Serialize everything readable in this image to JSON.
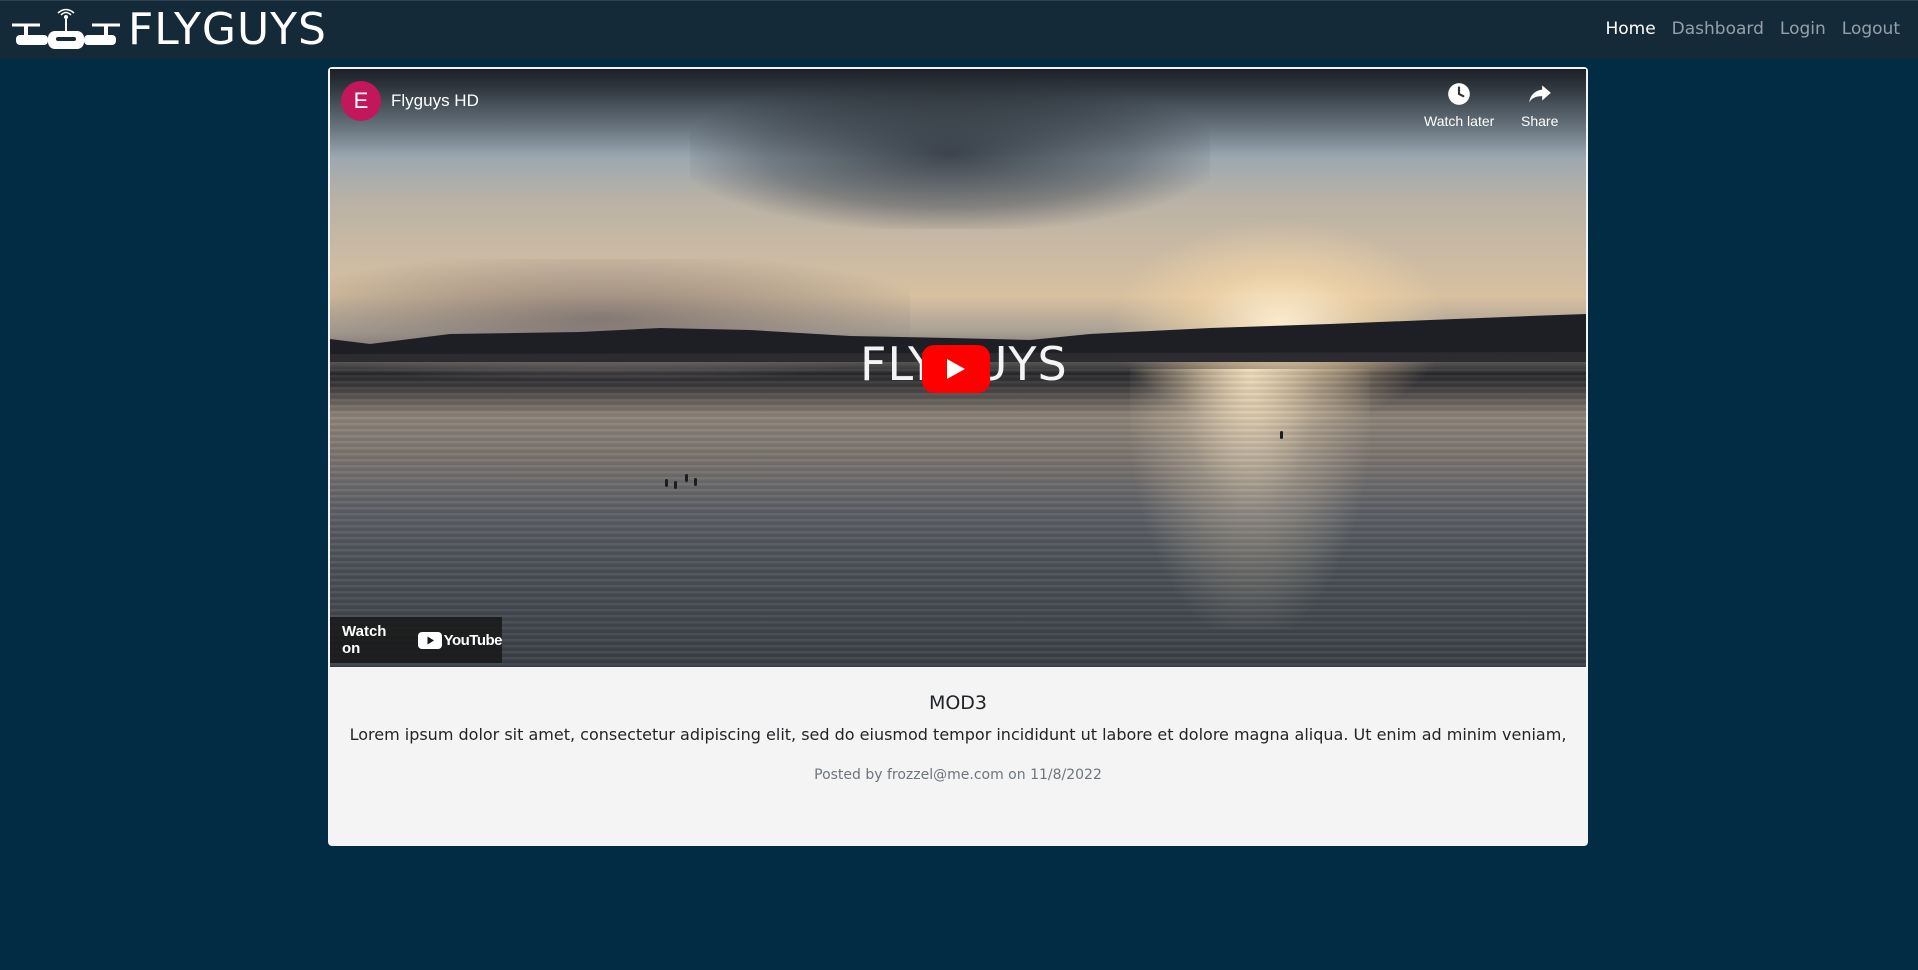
{
  "brand": {
    "name": "FLYGUYS",
    "logo_icon": "drone-icon"
  },
  "nav": {
    "items": [
      {
        "label": "Home",
        "active": true
      },
      {
        "label": "Dashboard",
        "active": false
      },
      {
        "label": "Login",
        "active": false
      },
      {
        "label": "Logout",
        "active": false
      }
    ]
  },
  "video": {
    "channel_initial": "E",
    "channel_name": "Flyguys HD",
    "watch_later_label": "Watch later",
    "share_label": "Share",
    "watermark": "FLYGUYS",
    "watch_on_label": "Watch on",
    "youtube_word": "YouTube"
  },
  "post": {
    "title": "MOD3",
    "body": "Lorem ipsum dolor sit amet, consectetur adipiscing elit, sed do eiusmod tempor incididunt ut labore et dolore magna aliqua. Ut enim ad minim veniam,",
    "meta": "Posted by frozzel@me.com on 11/8/2022"
  },
  "colors": {
    "page_background": "#022c43",
    "navbar_background": "#152a39",
    "card_background": "#f4f4f4",
    "play_button": "#ff0000",
    "channel_avatar": "#c2185b"
  }
}
